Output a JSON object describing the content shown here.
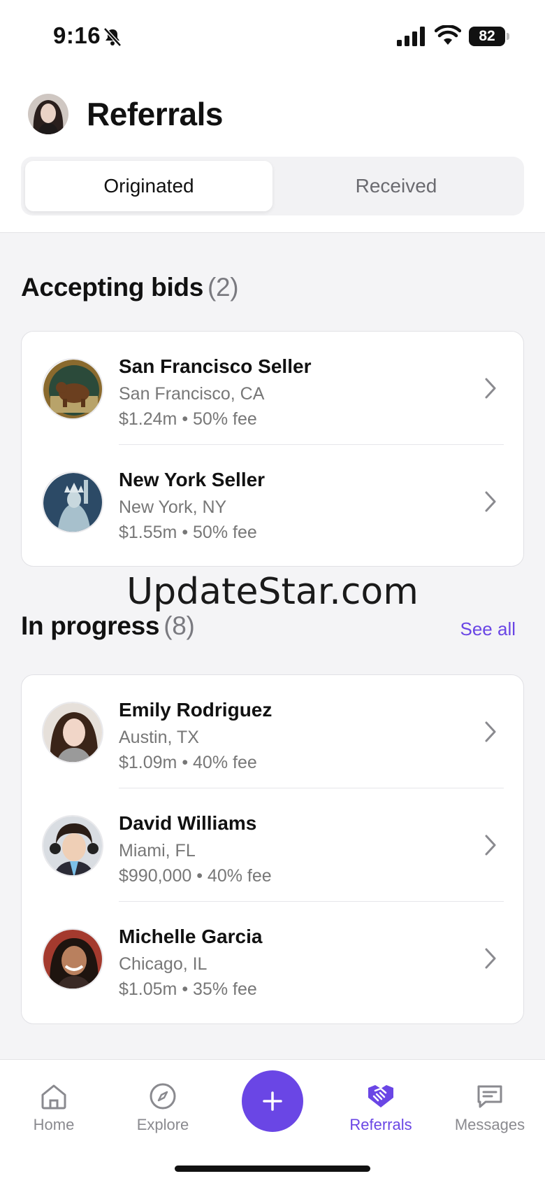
{
  "status": {
    "time": "9:16",
    "battery": "82"
  },
  "header": {
    "title": "Referrals"
  },
  "segments": {
    "originated": "Originated",
    "received": "Received"
  },
  "accepting": {
    "title": "Accepting bids",
    "count": "(2)",
    "items": [
      {
        "name": "San Francisco Seller",
        "location": "San Francisco, CA",
        "meta": "$1.24m • 50% fee",
        "avatar": "bear-seal-icon"
      },
      {
        "name": "New York Seller",
        "location": "New York, NY",
        "meta": "$1.55m • 50% fee",
        "avatar": "statue-of-liberty-icon"
      }
    ]
  },
  "watermark": "UpdateStar.com",
  "in_progress": {
    "title": "In progress",
    "count": "(8)",
    "see_all": "See all",
    "items": [
      {
        "name": "Emily Rodriguez",
        "location": "Austin, TX",
        "meta": "$1.09m • 40% fee",
        "avatar": "person-photo"
      },
      {
        "name": "David Williams",
        "location": "Miami, FL",
        "meta": "$990,000 • 40% fee",
        "avatar": "person-photo"
      },
      {
        "name": "Michelle Garcia",
        "location": "Chicago, IL",
        "meta": "$1.05m • 35% fee",
        "avatar": "person-photo"
      }
    ]
  },
  "tabbar": {
    "home": "Home",
    "explore": "Explore",
    "referrals": "Referrals",
    "messages": "Messages"
  },
  "colors": {
    "accent": "#6a46e5"
  }
}
